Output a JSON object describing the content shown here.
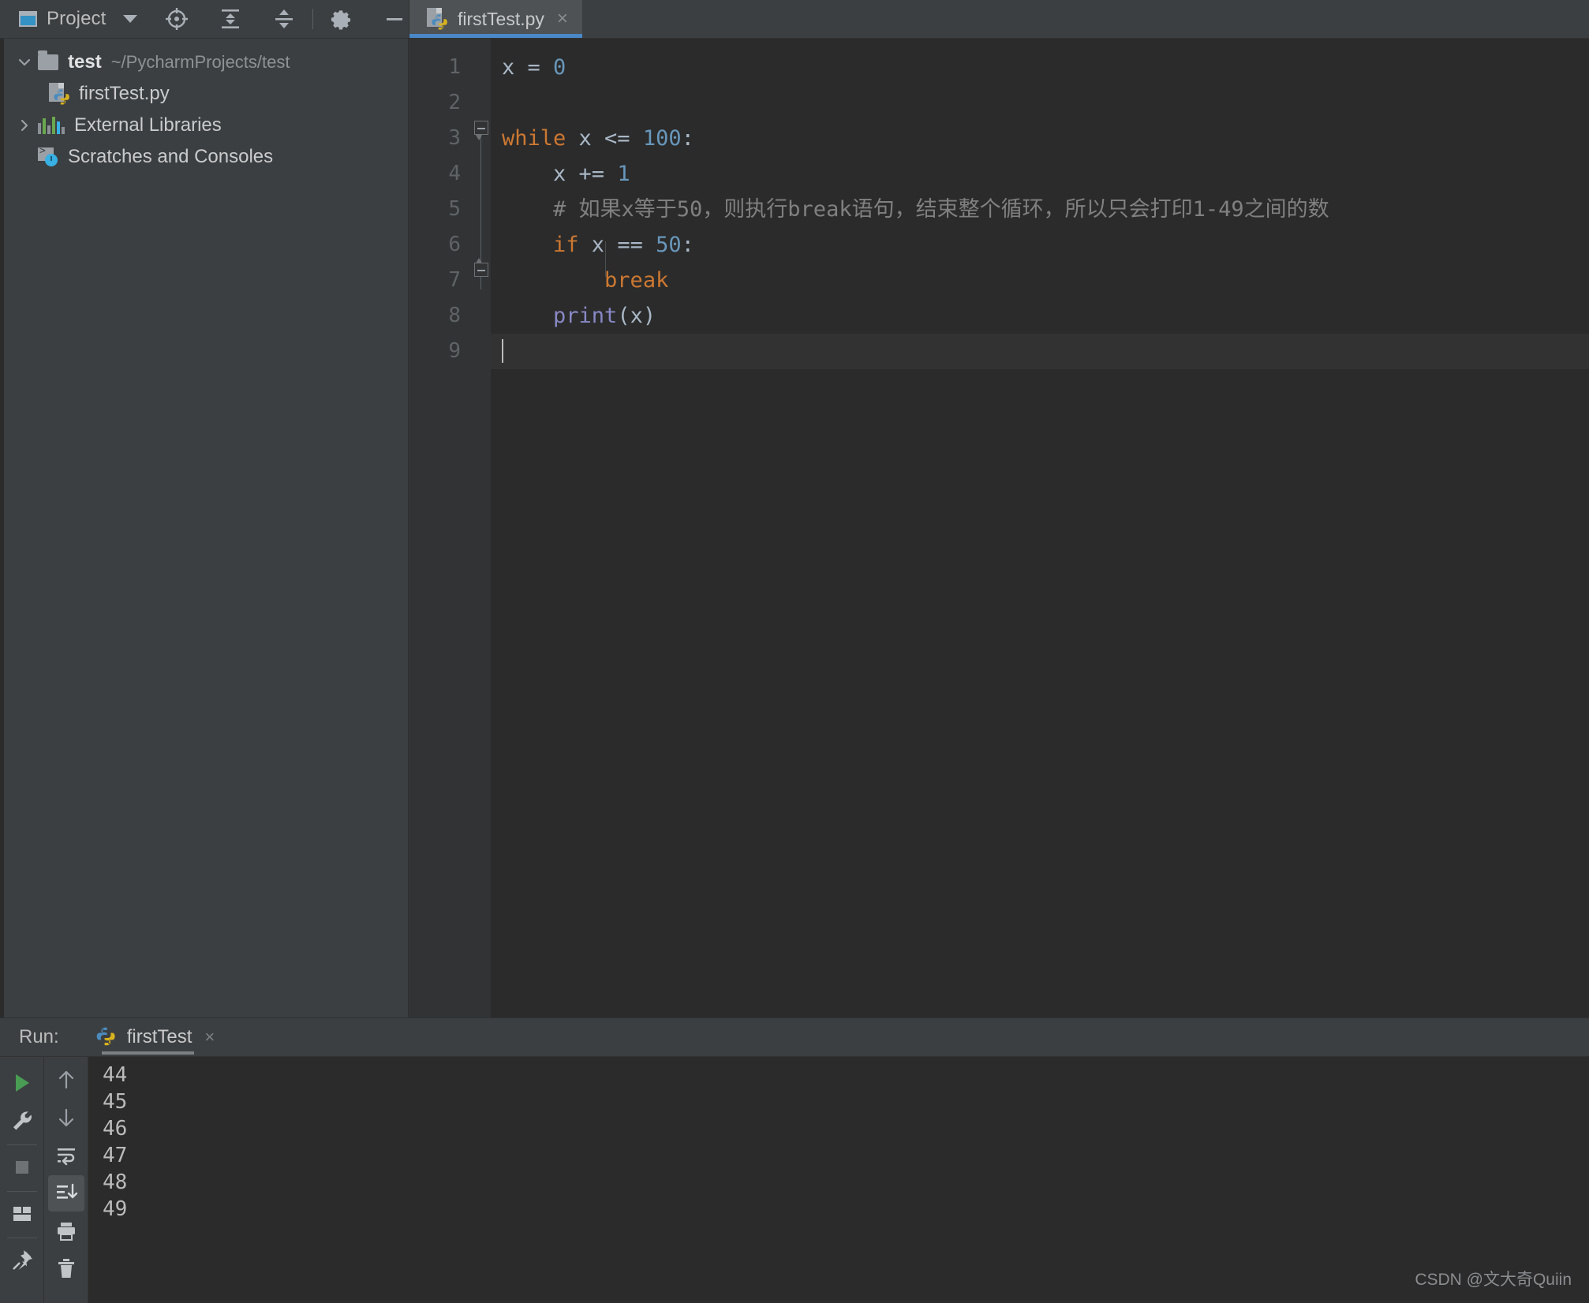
{
  "toolbar": {
    "project_label": "Project",
    "window_icon": "project-window-icon",
    "dropdown_icon": "chevron-down-icon",
    "locate_icon": "locate-target-icon",
    "expand_all_icon": "expand-all-icon",
    "collapse_all_icon": "collapse-all-icon",
    "settings_icon": "gear-icon",
    "hide_icon": "minimize-icon"
  },
  "editor_tabs": [
    {
      "label": "firstTest.py",
      "icon": "python-file-icon",
      "close": "×",
      "active": true
    }
  ],
  "sidebar": {
    "items": [
      {
        "label": "test",
        "path": "~/PycharmProjects/test",
        "icon": "folder-icon",
        "twisty": "chevron-down-icon",
        "expanded": true,
        "depth": 0
      },
      {
        "label": "firstTest.py",
        "path": "",
        "icon": "python-file-icon",
        "twisty": "",
        "expanded": false,
        "depth": 1
      },
      {
        "label": "External Libraries",
        "path": "",
        "icon": "library-icon",
        "twisty": "chevron-right-icon",
        "expanded": false,
        "depth": 0
      },
      {
        "label": "Scratches and Consoles",
        "path": "",
        "icon": "scratches-icon",
        "twisty": "",
        "expanded": false,
        "depth": 0
      }
    ]
  },
  "editor": {
    "language": "python",
    "line_numbers": [
      "1",
      "2",
      "3",
      "4",
      "5",
      "6",
      "7",
      "8",
      "9"
    ],
    "current_line": 9,
    "lines": [
      {
        "n": "1",
        "tokens": [
          {
            "t": "x = ",
            "c": "op"
          },
          {
            "t": "0",
            "c": "num"
          }
        ]
      },
      {
        "n": "2",
        "tokens": []
      },
      {
        "n": "3",
        "tokens": [
          {
            "t": "while",
            "c": "kw"
          },
          {
            "t": " x <= ",
            "c": "op"
          },
          {
            "t": "100",
            "c": "num"
          },
          {
            "t": ":",
            "c": "op"
          }
        ]
      },
      {
        "n": "4",
        "tokens": [
          {
            "t": "    x += ",
            "c": "op"
          },
          {
            "t": "1",
            "c": "num"
          }
        ]
      },
      {
        "n": "5",
        "tokens": [
          {
            "t": "    # 如果x等于50，则执行break语句，结束整个循环，所以只会打印1-49之间的数",
            "c": "cmt"
          }
        ]
      },
      {
        "n": "6",
        "tokens": [
          {
            "t": "    ",
            "c": "op"
          },
          {
            "t": "if",
            "c": "kw"
          },
          {
            "t": " x == ",
            "c": "op"
          },
          {
            "t": "50",
            "c": "num"
          },
          {
            "t": ":",
            "c": "op"
          }
        ]
      },
      {
        "n": "7",
        "tokens": [
          {
            "t": "        ",
            "c": "op"
          },
          {
            "t": "break",
            "c": "kw"
          }
        ]
      },
      {
        "n": "8",
        "tokens": [
          {
            "t": "    ",
            "c": "op"
          },
          {
            "t": "print",
            "c": "fn"
          },
          {
            "t": "(x)",
            "c": "op"
          }
        ]
      },
      {
        "n": "9",
        "tokens": []
      }
    ],
    "full_text": "x = 0\n\nwhile x <= 100:\n    x += 1\n    # 如果x等于50，则执行break语句，结束整个循环，所以只会打印1-49之间的数\n    if x == 50:\n        break\n    print(x)\n"
  },
  "run_panel": {
    "title": "Run:",
    "tab_label": "firstTest",
    "tab_icon": "python-file-icon",
    "tab_close": "×",
    "tools_left": [
      {
        "name": "rerun-button",
        "icon": "play-icon"
      },
      {
        "name": "edit-configurations-button",
        "icon": "wrench-icon"
      },
      {
        "name": "stop-button",
        "icon": "stop-square-icon"
      },
      {
        "name": "layout-button",
        "icon": "layout-icon"
      },
      {
        "name": "pin-tab-button",
        "icon": "pin-icon"
      }
    ],
    "tools_right": [
      {
        "name": "up-the-stack-trace-button",
        "icon": "arrow-up-icon"
      },
      {
        "name": "down-the-stack-trace-button",
        "icon": "arrow-down-icon"
      },
      {
        "name": "soft-wrap-button",
        "icon": "soft-wrap-icon"
      },
      {
        "name": "scroll-to-end-button",
        "icon": "scroll-to-end-icon",
        "selected": true
      },
      {
        "name": "print-button",
        "icon": "printer-icon"
      },
      {
        "name": "clear-all-button",
        "icon": "trash-icon"
      }
    ],
    "console_output": [
      "44",
      "45",
      "46",
      "47",
      "48",
      "49"
    ]
  },
  "watermark": "CSDN @文大奇Quiin",
  "colors": {
    "panel_bg": "#3c3f41",
    "editor_bg": "#2b2b2b",
    "gutter_bg": "#313335",
    "tab_active_bg": "#4e5254",
    "tab_underline": "#4a88c7",
    "text": "#bbbbbb",
    "keyword": "#cc7832",
    "number": "#6897bb",
    "comment": "#808080",
    "function": "#8888c6",
    "default_code": "#a9b7c6",
    "play_green": "#499c54"
  }
}
